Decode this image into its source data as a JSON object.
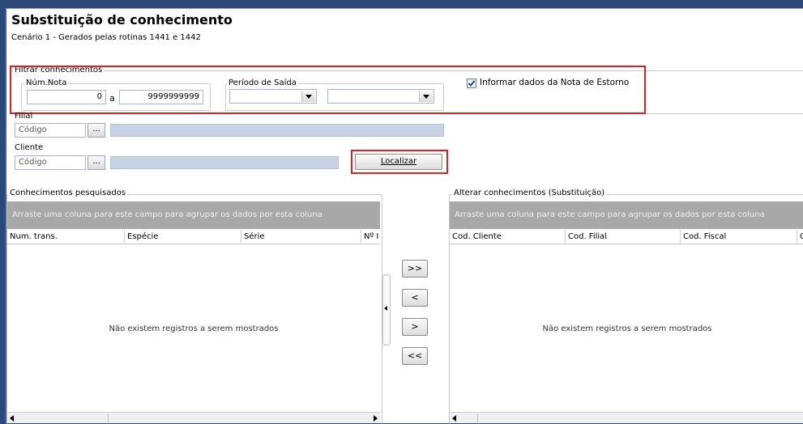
{
  "header": {
    "title": "Substituição de conhecimento",
    "subtitle": "Cenário 1 - Gerados pelas rotinas 1441 e 1442"
  },
  "filter": {
    "group_label": "Filtrar conhecimentos",
    "num_nota_label": "Núm.Nota",
    "num_nota_from": "0",
    "num_nota_sep": "a",
    "num_nota_to": "9999999999",
    "periodo_label": "Período de Saída",
    "periodo_from": "",
    "periodo_to": "",
    "estorno_checked": true,
    "estorno_label": "Informar dados da Nota de Estorno"
  },
  "filial": {
    "label": "Filial",
    "code_placeholder": "Código",
    "ellipsis": "...",
    "name": ""
  },
  "cliente": {
    "label": "Cliente",
    "code_placeholder": "Código",
    "ellipsis": "...",
    "name": ""
  },
  "localizar_label": "Localizar",
  "left_panel": {
    "label": "Conhecimentos pesquisados",
    "group_hint": "Arraste uma coluna para este campo para agrupar os dados por esta coluna",
    "columns": [
      "Num. trans.",
      "Espécie",
      "Série",
      "Nº I"
    ],
    "empty_text": "Não existem registros a serem mostrados"
  },
  "right_panel": {
    "label": "Alterar conhecimentos (Substituição)",
    "group_hint": "Arraste uma coluna para este campo para agrupar os dados por esta coluna",
    "columns": [
      "Cod. Cliente",
      "Cod. Filial",
      "Cod. Fiscal",
      "C"
    ],
    "empty_text": "Não existem registros a serem mostrados"
  },
  "move_buttons": {
    "add_all": ">>",
    "remove_one": "<",
    "add_one": ">",
    "remove_all": "<<"
  },
  "colors": {
    "highlight_red": "#e02020",
    "grid_header_gray": "#a8a8a8",
    "bar_blue": "#c7d3e4"
  }
}
